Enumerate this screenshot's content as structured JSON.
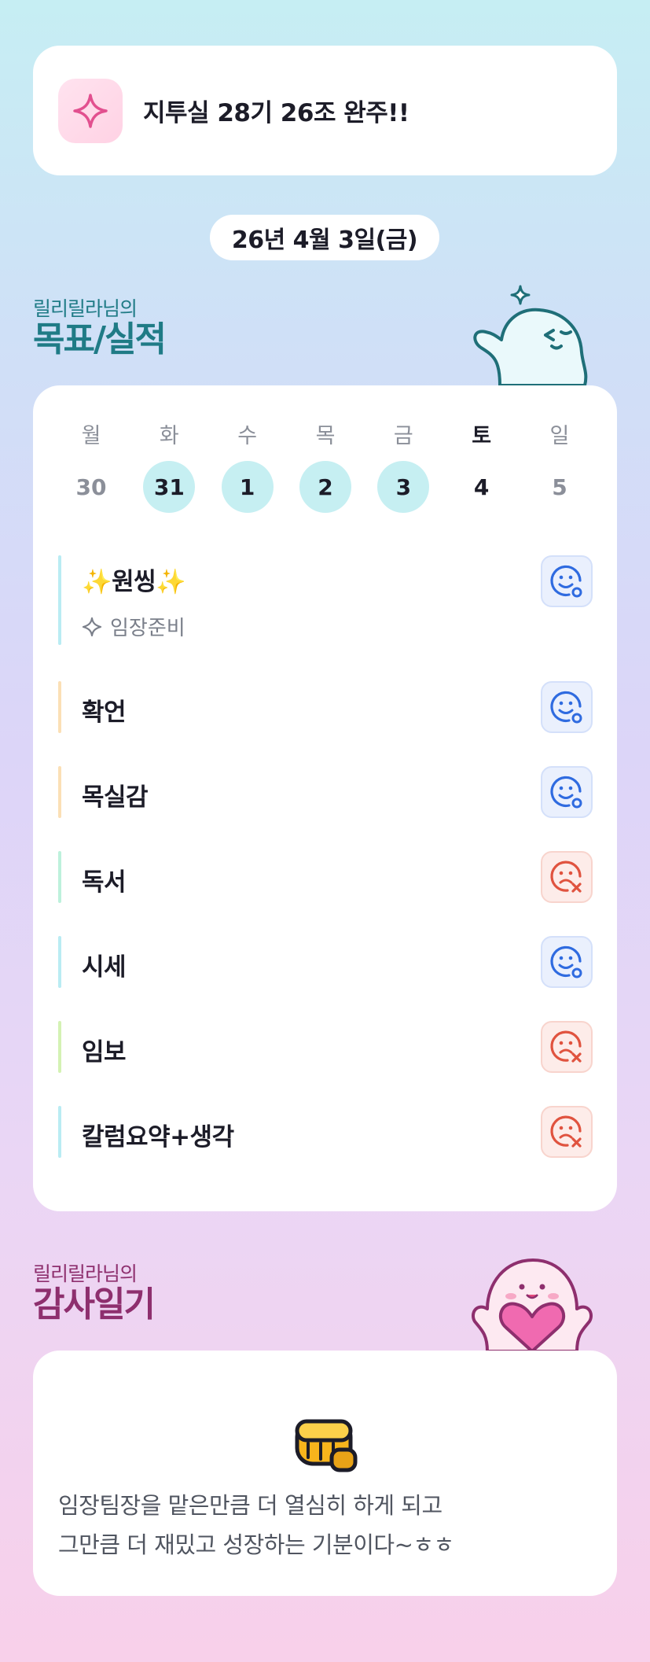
{
  "banner": {
    "title": "지투실 28기 26조 완주!!",
    "icon": "sparkle-icon"
  },
  "date": "26년 4월 3일(금)",
  "goals_section": {
    "subtitle": "릴리릴라님의",
    "title": "목표/실적"
  },
  "week": [
    {
      "name": "월",
      "num": "30",
      "state": "none"
    },
    {
      "name": "화",
      "num": "31",
      "state": "done"
    },
    {
      "name": "수",
      "num": "1",
      "state": "done"
    },
    {
      "name": "목",
      "num": "2",
      "state": "done"
    },
    {
      "name": "금",
      "num": "3",
      "state": "done"
    },
    {
      "name": "토",
      "num": "4",
      "state": "today"
    },
    {
      "name": "일",
      "num": "5",
      "state": "none"
    }
  ],
  "goals": [
    {
      "label": "✨원씽✨",
      "sub": "임장준비",
      "status": "success",
      "bar_color": "#b9ecf3"
    },
    {
      "label": "확언",
      "status": "success",
      "bar_color": "#fbe0b6"
    },
    {
      "label": "목실감",
      "status": "success",
      "bar_color": "#fbe0b6"
    },
    {
      "label": "독서",
      "status": "fail",
      "bar_color": "#bdf1dc"
    },
    {
      "label": "시세",
      "status": "success",
      "bar_color": "#b9ecf3"
    },
    {
      "label": "임보",
      "status": "fail",
      "bar_color": "#d4f2b4"
    },
    {
      "label": "칼럼요약+생각",
      "status": "fail",
      "bar_color": "#b9ecf3"
    }
  ],
  "thanks_section": {
    "subtitle": "릴리릴라님의",
    "title": "감사일기"
  },
  "thanks": {
    "emoji": "fist-icon",
    "line1": "임장팀장을 맡은만큼 더 열심히 하게 되고",
    "line2": "그만큼 더 재밌고 성장하는 기분이다~ㅎㅎ"
  },
  "colors": {
    "success": "#2f6be0",
    "fail": "#e0533f",
    "accent_teal": "#1f7b86",
    "accent_plum": "#8e2f6e"
  }
}
